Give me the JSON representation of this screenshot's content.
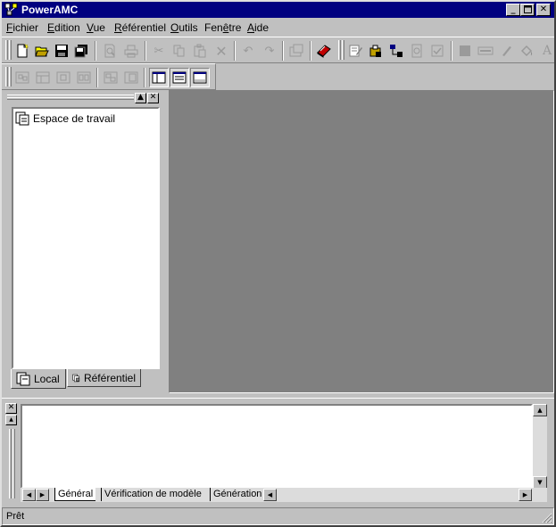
{
  "title": "PowerAMC",
  "menu": [
    {
      "label": "Fichier",
      "u": "F",
      "rest": "ichier"
    },
    {
      "label": "Edition",
      "u": "E",
      "rest": "dition"
    },
    {
      "label": "Vue",
      "u": "V",
      "rest": "ue"
    },
    {
      "label": "Référentiel",
      "u": "R",
      "rest": "éférentiel"
    },
    {
      "label": "Outils",
      "u": "O",
      "rest": "utils"
    },
    {
      "label": "Fenêtre",
      "pre": "Fen",
      "u": "ê",
      "rest": "tre"
    },
    {
      "label": "Aide",
      "u": "A",
      "rest": "ide"
    }
  ],
  "browser": {
    "root_label": "Espace de travail",
    "tabs": [
      {
        "label": "Local"
      },
      {
        "label": "Référentiel"
      }
    ]
  },
  "output": {
    "tabs": [
      {
        "label": "Général"
      },
      {
        "label": "Vérification de modèle"
      },
      {
        "label": "Génération"
      }
    ]
  },
  "status": "Prêt"
}
